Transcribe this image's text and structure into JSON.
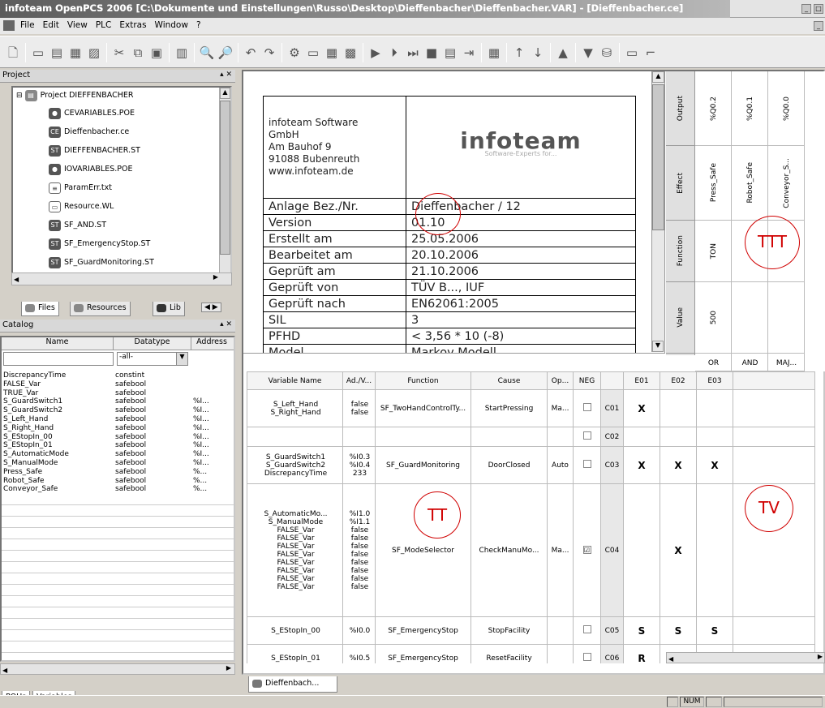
{
  "window": {
    "title": "infoteam OpenPCS 2006 [C:\\Dokumente und Einstellungen\\Russo\\Desktop\\Dieffenbacher\\Dieffenbacher.VAR] - [Dieffenbacher.ce]"
  },
  "menu": [
    "File",
    "Edit",
    "View",
    "PLC",
    "Extras",
    "Window",
    "?"
  ],
  "project": {
    "header": "Project",
    "root": "Project DIEFFENBACHER",
    "items": [
      {
        "label": "CEVARIABLES.POE",
        "icon": "poe-icon"
      },
      {
        "label": "Dieffenbacher.ce",
        "icon": "ce-icon"
      },
      {
        "label": "DIEFFENBACHER.ST",
        "icon": "st-icon"
      },
      {
        "label": "IOVARIABLES.POE",
        "icon": "poe-icon"
      },
      {
        "label": "ParamErr.txt",
        "icon": "txt-icon"
      },
      {
        "label": "Resource.WL",
        "icon": "wl-icon"
      },
      {
        "label": "SF_AND.ST",
        "icon": "st-icon"
      },
      {
        "label": "SF_EmergencyStop.ST",
        "icon": "st-icon"
      },
      {
        "label": "SF_GuardMonitoring.ST",
        "icon": "st-icon"
      }
    ],
    "tabs": [
      "Files",
      "Resources",
      "Lib"
    ]
  },
  "catalog": {
    "header": "Catalog",
    "columns": [
      "Name",
      "Datatype",
      "Address"
    ],
    "filter": "-all-",
    "rows": [
      [
        "DiscrepancyTime",
        "constint",
        ""
      ],
      [
        "FALSE_Var",
        "safebool",
        ""
      ],
      [
        "TRUE_Var",
        "safebool",
        ""
      ],
      [
        "S_GuardSwitch1",
        "safebool",
        "%I..."
      ],
      [
        "S_GuardSwitch2",
        "safebool",
        "%I..."
      ],
      [
        "S_Left_Hand",
        "safebool",
        "%I..."
      ],
      [
        "S_Right_Hand",
        "safebool",
        "%I..."
      ],
      [
        "S_EStopIn_00",
        "safebool",
        "%I..."
      ],
      [
        "S_EStopIn_01",
        "safebool",
        "%I..."
      ],
      [
        "S_AutomaticMode",
        "safebool",
        "%I..."
      ],
      [
        "S_ManualMode",
        "safebool",
        "%I..."
      ],
      [
        "Press_Safe",
        "safebool",
        "%..."
      ],
      [
        "Robot_Safe",
        "safebool",
        "%..."
      ],
      [
        "Conveyor_Safe",
        "safebool",
        "%..."
      ]
    ],
    "tabs": [
      "POUs",
      "Variables"
    ]
  },
  "cover": {
    "company": [
      "infoteam Software",
      "GmbH",
      "Am Bauhof 9",
      "91088 Bubenreuth",
      "www.infoteam.de"
    ],
    "logo": "infoteam",
    "logo_sub": "Software-Experts for...",
    "rows": [
      [
        "Anlage Bez./Nr.",
        "Dieffenbacher / 12"
      ],
      [
        "Version",
        "01.10"
      ],
      [
        "Erstellt am",
        "25.05.2006"
      ],
      [
        "Bearbeitet am",
        "20.10.2006"
      ],
      [
        "Geprüft am",
        "21.10.2006"
      ],
      [
        "Geprüft von",
        "TÜV B..., IUF"
      ],
      [
        "Geprüft nach",
        "EN62061:2005"
      ],
      [
        "SIL",
        "3"
      ],
      [
        "PFHD",
        "< 3,56 * 10 (-8)"
      ],
      [
        "Model",
        "Markov Modell"
      ]
    ]
  },
  "effects": {
    "row_labels": [
      "Output",
      "Effect",
      "Function",
      "Value"
    ],
    "columns": [
      {
        "output": "%Q0.2",
        "effect": "Press_Safe",
        "function": "TON",
        "value": "500",
        "logic": "OR",
        "id": "E01"
      },
      {
        "output": "%Q0.1",
        "effect": "Robot_Safe",
        "function": "",
        "value": "",
        "logic": "AND",
        "id": "E02"
      },
      {
        "output": "%Q0.0",
        "effect": "Conveyor_S...",
        "function": "",
        "value": "",
        "logic": "MAJ...",
        "id": "E03"
      }
    ]
  },
  "causes": {
    "columns": [
      "Variable Name",
      "Ad./V...",
      "Function",
      "Cause",
      "Op...",
      "NEG"
    ],
    "rows": [
      {
        "id": "C01",
        "vars": [
          "S_Left_Hand",
          "S_Right_Hand"
        ],
        "addr": [
          "false",
          "false"
        ],
        "function": "SF_TwoHandControlTy...",
        "cause": "StartPressing",
        "op": "Ma...",
        "neg": "",
        "marks": [
          "X",
          "",
          ""
        ]
      },
      {
        "id": "C02",
        "vars": [],
        "addr": [],
        "function": "",
        "cause": "",
        "op": "",
        "neg": "",
        "marks": [
          "",
          "",
          ""
        ]
      },
      {
        "id": "C03",
        "vars": [
          "S_GuardSwitch1",
          "S_GuardSwitch2",
          "DiscrepancyTime"
        ],
        "addr": [
          "%I0.3",
          "%I0.4",
          "233"
        ],
        "function": "SF_GuardMonitoring",
        "cause": "DoorClosed",
        "op": "Auto",
        "neg": "",
        "marks": [
          "X",
          "X",
          "X"
        ]
      },
      {
        "id": "C04",
        "vars": [
          "S_AutomaticMo...",
          "S_ManualMode",
          "FALSE_Var",
          "FALSE_Var",
          "FALSE_Var",
          "FALSE_Var",
          "FALSE_Var",
          "FALSE_Var",
          "FALSE_Var",
          "FALSE_Var"
        ],
        "addr": [
          "%I1.0",
          "%I1.1",
          "false",
          "false",
          "false",
          "false",
          "false",
          "false",
          "false",
          "false"
        ],
        "function": "SF_ModeSelector",
        "cause": "CheckManuMo...",
        "op": "Ma...",
        "neg": "☑",
        "marks": [
          "",
          "X",
          ""
        ]
      },
      {
        "id": "C05",
        "vars": [
          "S_EStopIn_00"
        ],
        "addr": [
          "%I0.0"
        ],
        "function": "SF_EmergencyStop",
        "cause": "StopFacility",
        "op": "",
        "neg": "",
        "marks": [
          "S",
          "S",
          "S"
        ]
      },
      {
        "id": "C06",
        "vars": [
          "S_EStopIn_01"
        ],
        "addr": [
          "%I0.5"
        ],
        "function": "SF_EmergencyStop",
        "cause": "ResetFacility",
        "op": "",
        "neg": "",
        "marks": [
          "R",
          "R",
          "R"
        ]
      }
    ]
  },
  "annotations": {
    "tt": "TT",
    "ttt": "TTT",
    "tv": "TV"
  },
  "doc_tab": "Dieffenbach...",
  "status": {
    "num": "NUM"
  }
}
